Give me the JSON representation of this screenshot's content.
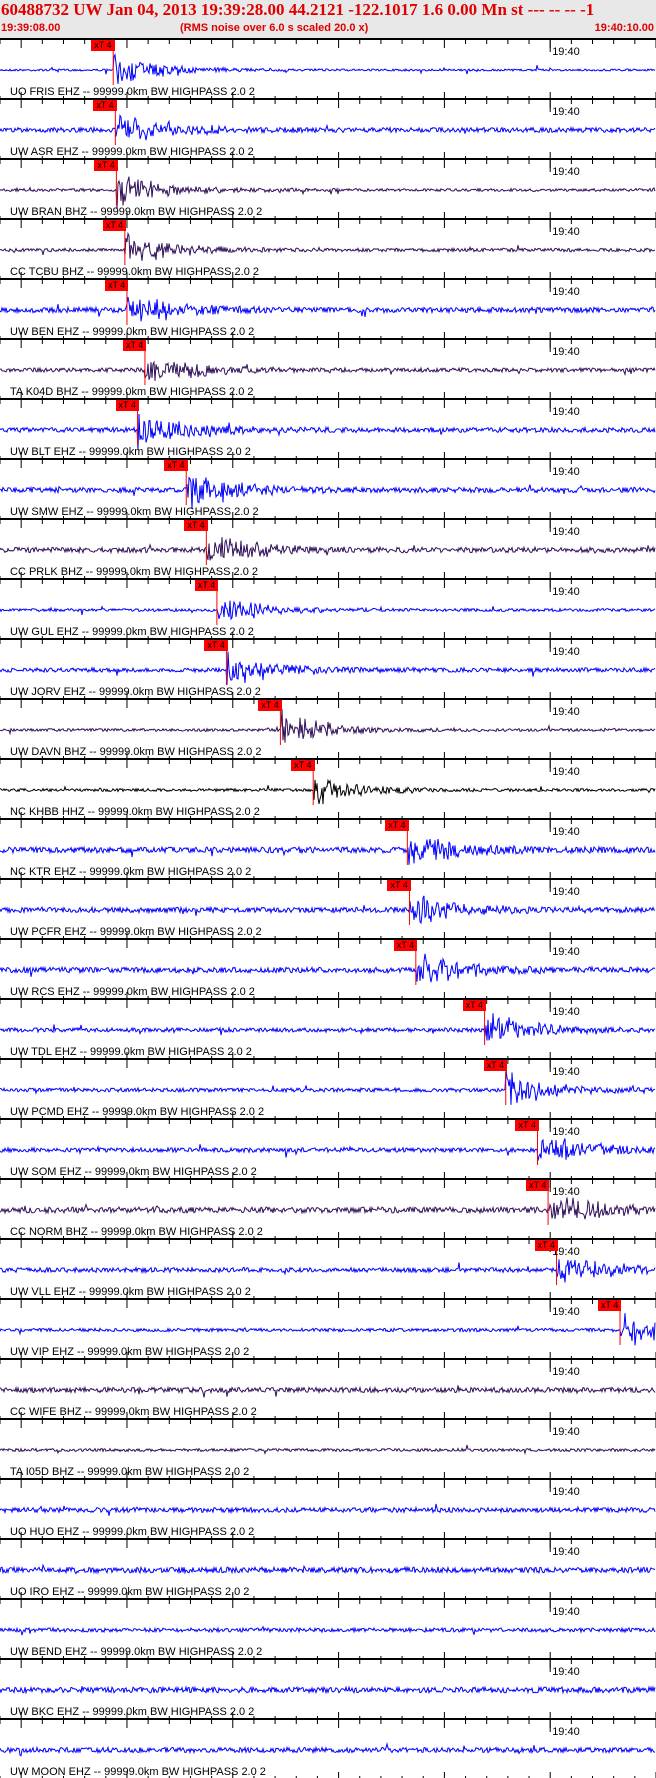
{
  "header": {
    "title": "60488732 UW Jan 04, 2013 19:39:28.00   44.2121 -122.1017  1.6 0.00 Mn st --- -- --  -1",
    "start_time": "19:39:08.00",
    "noise_note": "(RMS noise over 6.0 s scaled 20.0 x)",
    "end_time": "19:40:10.00"
  },
  "chart_data": {
    "type": "line",
    "title": "Seismogram traces",
    "time_window_s": 62,
    "minute_tick_label": "19:40",
    "minute_tick_offset_s": 52,
    "pick_label": "xT 4",
    "traces": [
      {
        "label": "UO FRIS EHZ -- 99999.0km BW  HIGHPASS  2.0  2",
        "color": "#0000ff",
        "pick_s": 10.7
      },
      {
        "label": "UW ASR EHZ -- 99999.0km BW  HIGHPASS  2.0  2",
        "color": "#0000ff",
        "pick_s": 10.9
      },
      {
        "label": "UW BRAN BHZ -- 99999.0km BW  HIGHPASS  2.0  2",
        "color": "#30105a",
        "pick_s": 11.0
      },
      {
        "label": "CC TCBU BHZ -- 99999.0km BW  HIGHPASS  2.0  2",
        "color": "#30105a",
        "pick_s": 11.8
      },
      {
        "label": "UW BEN EHZ -- 99999.0km BW  HIGHPASS  2.0  2",
        "color": "#0000ff",
        "pick_s": 12.0
      },
      {
        "label": "TA K04D BHZ -- 99999.0km BW  HIGHPASS  2.0  2",
        "color": "#30105a",
        "pick_s": 13.7
      },
      {
        "label": "UW BLT EHZ -- 99999.0km BW  HIGHPASS  2.0  2",
        "color": "#0000ff",
        "pick_s": 13.0
      },
      {
        "label": "UW SMW EHZ -- 99999.0km BW  HIGHPASS  2.0  2",
        "color": "#0000ff",
        "pick_s": 17.6
      },
      {
        "label": "CC PRLK BHZ -- 99999.0km BW  HIGHPASS  2.0  2",
        "color": "#30105a",
        "pick_s": 19.5
      },
      {
        "label": "UW GUL EHZ -- 99999.0km BW  HIGHPASS  2.0  2",
        "color": "#0000ff",
        "pick_s": 20.5
      },
      {
        "label": "UW JORV EHZ -- 99999.0km BW  HIGHPASS  2.0  2",
        "color": "#0000ff",
        "pick_s": 21.4
      },
      {
        "label": "UW DAVN BHZ -- 99999.0km BW  HIGHPASS  2.0  2",
        "color": "#30105a",
        "pick_s": 26.5
      },
      {
        "label": "NC KHBB HHZ -- 99999.0km BW  HIGHPASS  2.0  2",
        "color": "#000000",
        "pick_s": 29.6
      },
      {
        "label": "NC KTR EHZ -- 99999.0km BW  HIGHPASS  2.0  2",
        "color": "#0000ff",
        "pick_s": 38.5
      },
      {
        "label": "UW PCFR EHZ -- 99999.0km BW  HIGHPASS  2.0  2",
        "color": "#0000ff",
        "pick_s": 38.7
      },
      {
        "label": "UW RCS EHZ -- 99999.0km BW  HIGHPASS  2.0  2",
        "color": "#0000ff",
        "pick_s": 39.3
      },
      {
        "label": "UW TDL EHZ -- 99999.0km BW  HIGHPASS  2.0  2",
        "color": "#0000ff",
        "pick_s": 45.8
      },
      {
        "label": "UW PCMD EHZ -- 99999.0km BW  HIGHPASS  2.0  2",
        "color": "#0000ff",
        "pick_s": 47.8
      },
      {
        "label": "UW SOM EHZ -- 99999.0km BW  HIGHPASS  2.0  2",
        "color": "#0000ff",
        "pick_s": 50.8
      },
      {
        "label": "CC NORM BHZ -- 99999.0km BW  HIGHPASS  2.0  2",
        "color": "#30105a",
        "pick_s": 51.8
      },
      {
        "label": "UW VLL EHZ -- 99999.0km BW  HIGHPASS  2.0  2",
        "color": "#0000ff",
        "pick_s": 52.6
      },
      {
        "label": "UW VIP EHZ -- 99999.0km BW  HIGHPASS  2.0  2",
        "color": "#0000ff",
        "pick_s": 58.6
      },
      {
        "label": "CC WIFE BHZ -- 99999.0km BW  HIGHPASS  2.0  2",
        "color": "#30105a",
        "pick_s": null
      },
      {
        "label": "TA I05D BHZ -- 99999.0km BW  HIGHPASS  2.0  2",
        "color": "#30105a",
        "pick_s": null
      },
      {
        "label": "UO HUO EHZ -- 99999.0km BW  HIGHPASS  2.0  2",
        "color": "#0000ff",
        "pick_s": null
      },
      {
        "label": "UO IRO EHZ -- 99999.0km BW  HIGHPASS  2.0  2",
        "color": "#0000ff",
        "pick_s": null
      },
      {
        "label": "UW BEND EHZ -- 99999.0km BW  HIGHPASS  2.0  2",
        "color": "#0000ff",
        "pick_s": null
      },
      {
        "label": "UW BKC EHZ -- 99999.0km BW  HIGHPASS  2.0  2",
        "color": "#0000ff",
        "pick_s": null
      },
      {
        "label": "UW MOON EHZ -- 99999.0km BW  HIGHPASS  2.0  2",
        "color": "#0000ff",
        "pick_s": null
      }
    ]
  }
}
